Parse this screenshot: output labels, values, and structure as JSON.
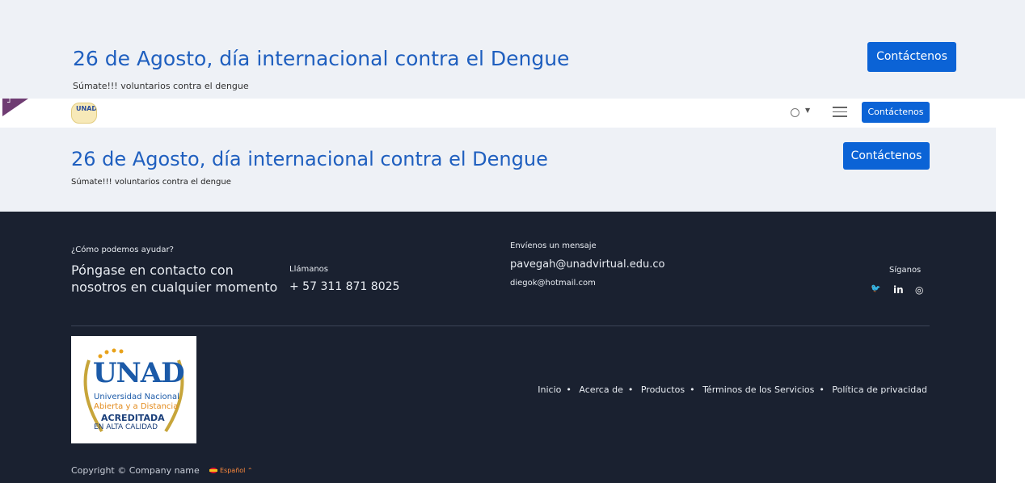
{
  "hero_top": {
    "title": "26 de Agosto, día internacional contra el Dengue",
    "subtitle": "Súmate!!! voluntarios contra el dengue",
    "button_label": "Contáctenos"
  },
  "navbar": {
    "logo_text": "UNAD",
    "button_label": "Contáctenos",
    "corner_mark": "┘"
  },
  "hero": {
    "title": "26 de Agosto, día internacional contra el Dengue",
    "subtitle": "Súmate!!! voluntarios contra el dengue",
    "button_label": "Contáctenos"
  },
  "footer": {
    "help_label": "¿Cómo podemos ayudar?",
    "help_line1": "Póngase en contacto con",
    "help_line2": "nosotros en cualquier momento",
    "call_label": "Llámanos",
    "phone": "+ 57  311 871 8025",
    "message_label": "Envíenos un mensaje",
    "email_primary": "pavegah@unadvirtual.edu.co",
    "email_secondary": "diegok@hotmail.com",
    "follow_label": "Síganos",
    "social": [
      "twitter-icon",
      "linkedin-icon",
      "instagram-icon"
    ],
    "social_glyphs": {
      "twitter": "🐦",
      "linkedin": "in",
      "instagram": "◎"
    },
    "links": [
      "Inicio",
      "Acerca de",
      "Productos",
      "Términos de los Servicios",
      "Política de privacidad"
    ],
    "copyright": "Copyright © Company name",
    "language": "Español ⌃",
    "logo": {
      "brand": "UNAD",
      "line1": "Universidad Nacional",
      "line2": "Abierta y a Distancia",
      "line3": "ACREDITADA",
      "line4": "EN ALTA CALIDAD"
    }
  },
  "colors": {
    "accent": "#0b63d6",
    "title_blue": "#1f5fbf",
    "footer_bg": "#1a2130",
    "hero_bg": "#eef1f6"
  }
}
